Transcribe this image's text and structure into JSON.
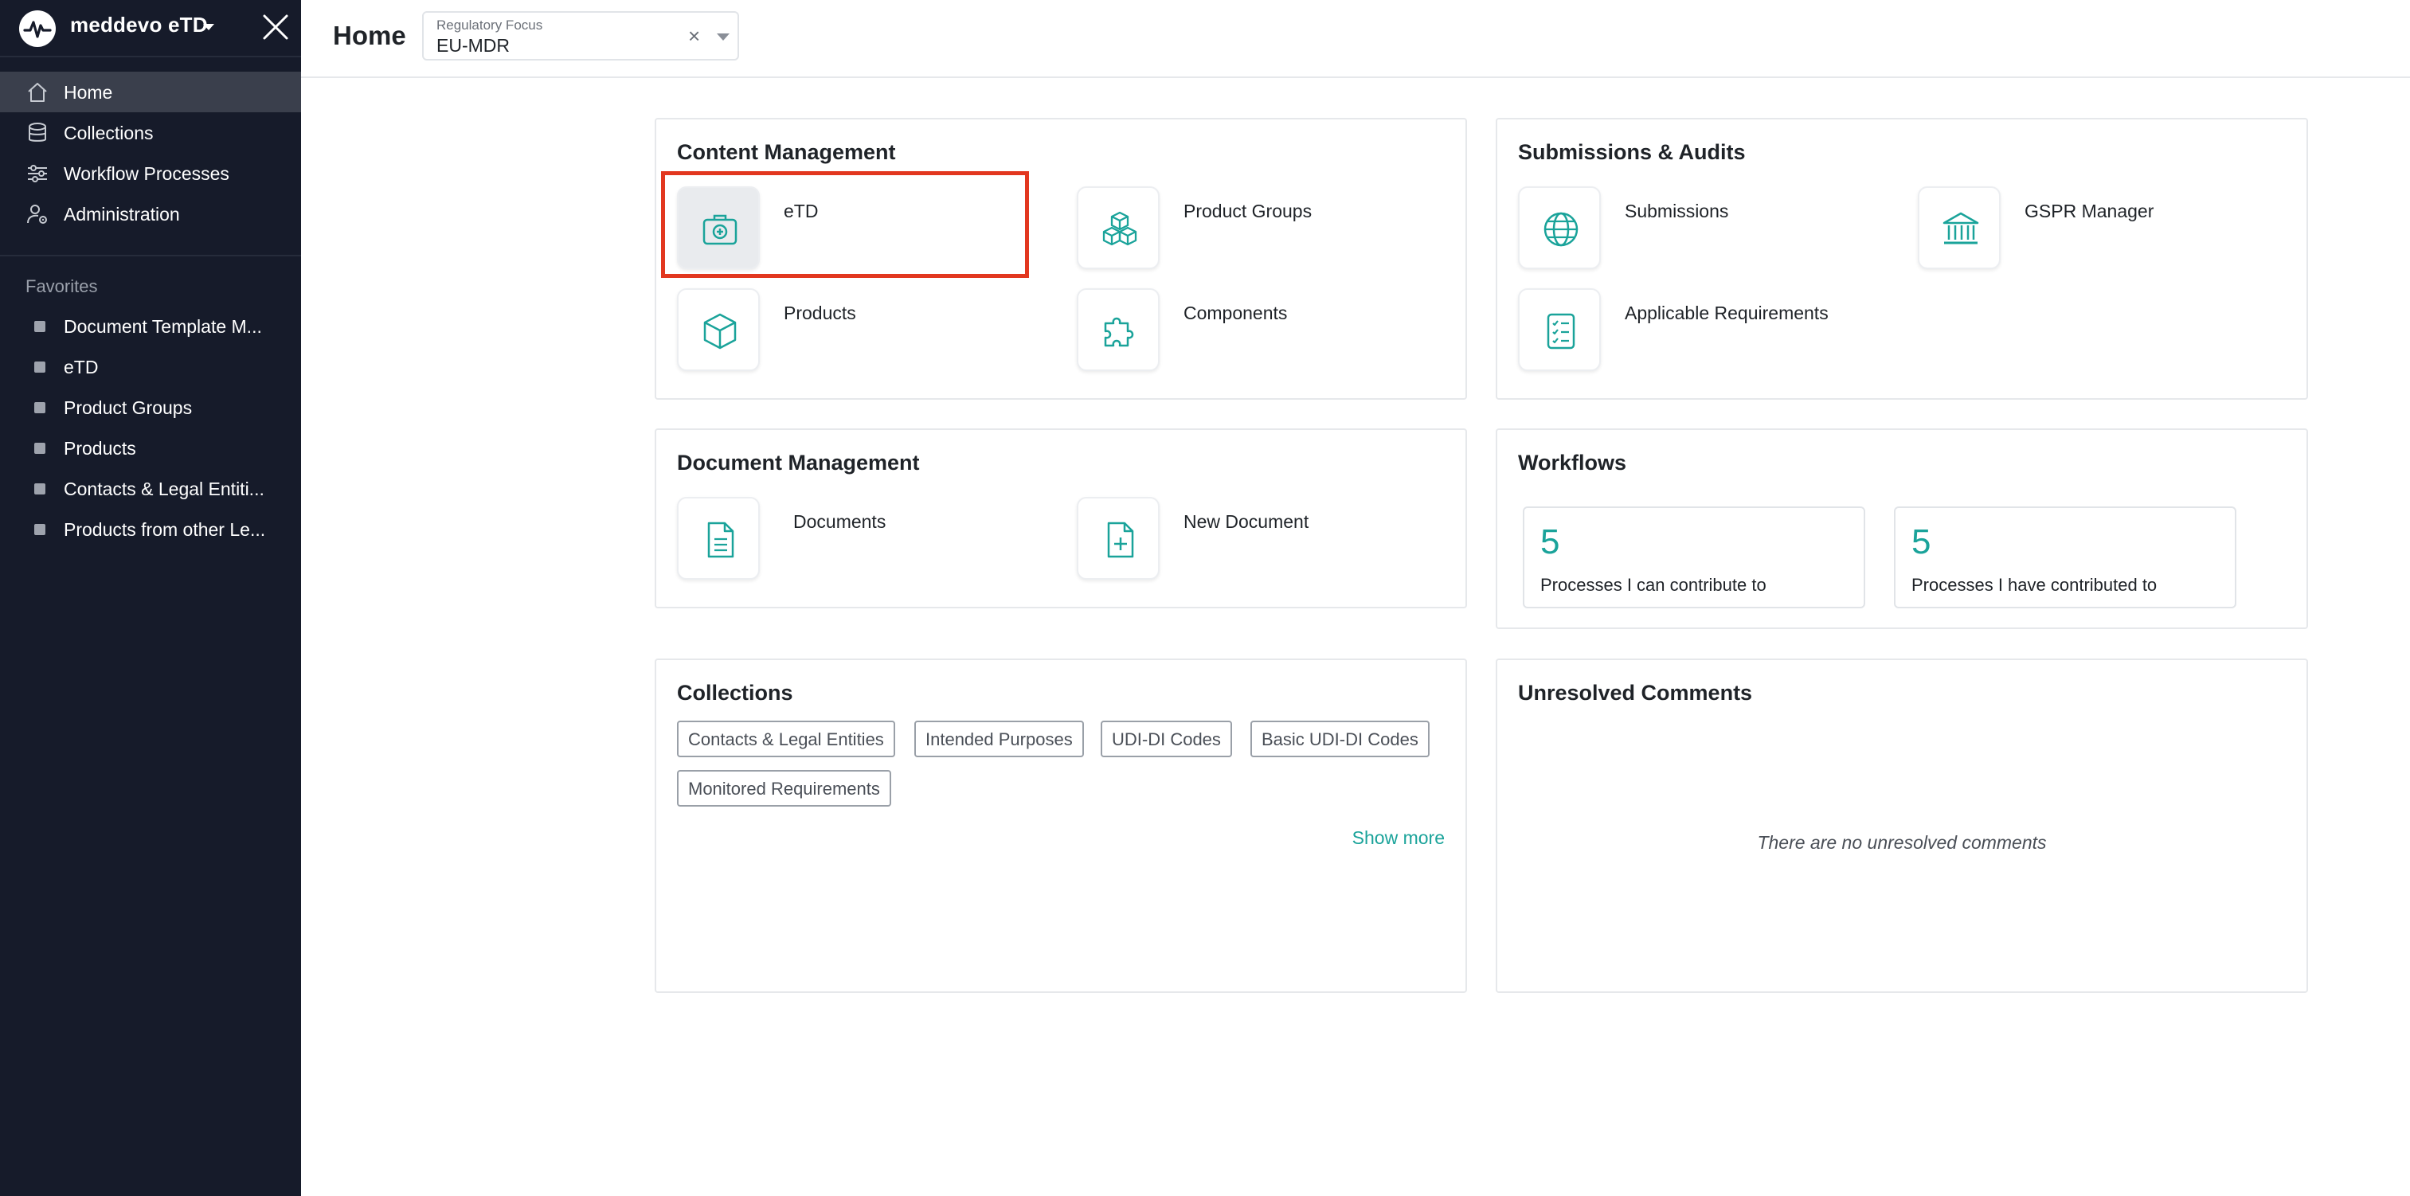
{
  "app": {
    "name": "meddevo eTD"
  },
  "sidebar": {
    "nav": [
      {
        "label": "Home",
        "icon": "home-icon",
        "active": true
      },
      {
        "label": "Collections",
        "icon": "database-icon"
      },
      {
        "label": "Workflow Processes",
        "icon": "workflow-icon"
      },
      {
        "label": "Administration",
        "icon": "user-gear-icon"
      }
    ],
    "favorites_heading": "Favorites",
    "favorites": [
      {
        "label": "Document Template M..."
      },
      {
        "label": "eTD"
      },
      {
        "label": "Product Groups"
      },
      {
        "label": "Products"
      },
      {
        "label": "Contacts & Legal Entiti..."
      },
      {
        "label": "Products from other Le..."
      }
    ]
  },
  "header": {
    "title": "Home",
    "focus": {
      "label": "Regulatory Focus",
      "value": "EU-MDR",
      "clear": "×"
    }
  },
  "content_management": {
    "title": "Content Management",
    "tiles": [
      {
        "label": "eTD",
        "icon": "medical-kit-icon"
      },
      {
        "label": "Product Groups",
        "icon": "cubes-icon"
      },
      {
        "label": "Products",
        "icon": "box-icon"
      },
      {
        "label": "Components",
        "icon": "puzzle-icon"
      }
    ]
  },
  "submissions": {
    "title": "Submissions & Audits",
    "tiles": [
      {
        "label": "Submissions",
        "icon": "globe-icon"
      },
      {
        "label": "GSPR Manager",
        "icon": "bank-icon"
      },
      {
        "label": "Applicable Requirements",
        "icon": "checklist-icon"
      }
    ]
  },
  "document_management": {
    "title": "Document Management",
    "tiles": [
      {
        "label": "Documents",
        "icon": "document-icon"
      },
      {
        "label": "New Document",
        "icon": "new-document-icon"
      }
    ]
  },
  "workflows": {
    "title": "Workflows",
    "stats": [
      {
        "value": "5",
        "label": "Processes I can contribute to"
      },
      {
        "value": "5",
        "label": "Processes I have contributed to"
      }
    ]
  },
  "collections": {
    "title": "Collections",
    "tags": [
      "Contacts & Legal Entities",
      "Intended Purposes",
      "UDI-DI Codes",
      "Basic UDI-DI Codes",
      "Monitored Requirements"
    ],
    "show_more": "Show more"
  },
  "comments": {
    "title": "Unresolved Comments",
    "empty": "There are no unresolved comments"
  },
  "colors": {
    "sidebar": "#161b2a",
    "accent": "#1aa39a",
    "highlight": "#e2371f"
  }
}
